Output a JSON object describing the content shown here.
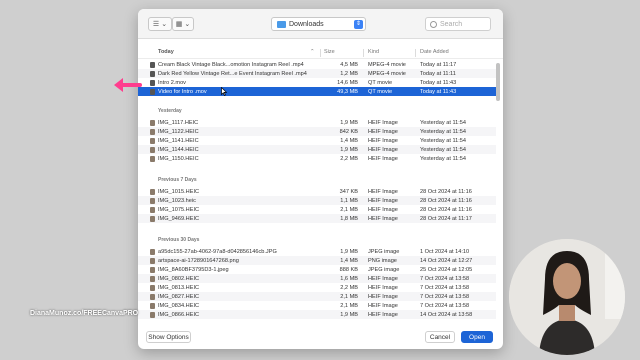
{
  "toolbar": {
    "location": "Downloads",
    "search_placeholder": "Search"
  },
  "columns": {
    "name": "Today",
    "size": "Size",
    "kind": "Kind",
    "date": "Date Added"
  },
  "sections": {
    "today": "Today",
    "yesterday": "Yesterday",
    "prev7": "Previous 7 Days",
    "prev30": "Previous 30 Days"
  },
  "files": {
    "today": [
      {
        "name": "Cream Black Vintage Black...omotion Instagram Reel .mp4",
        "size": "4,5 MB",
        "kind": "MPEG-4 movie",
        "date": "Today at 11:17"
      },
      {
        "name": "Dark Red Yellow Vintage Ret...e Event Instagram Reel .mp4",
        "size": "1,2 MB",
        "kind": "MPEG-4 movie",
        "date": "Today at 11:11"
      },
      {
        "name": "Intro 2.mov",
        "size": "14,6 MB",
        "kind": "QT movie",
        "date": "Today at 11:43"
      },
      {
        "name": "Video for Intro .mov",
        "size": "49,3 MB",
        "kind": "QT movie",
        "date": "Today at 11:43"
      }
    ],
    "yesterday": [
      {
        "name": "IMG_1117.HEIC",
        "size": "1,9 MB",
        "kind": "HEIF Image",
        "date": "Yesterday at 11:54"
      },
      {
        "name": "IMG_1122.HEIC",
        "size": "842 KB",
        "kind": "HEIF Image",
        "date": "Yesterday at 11:54"
      },
      {
        "name": "IMG_1141.HEIC",
        "size": "1,4 MB",
        "kind": "HEIF Image",
        "date": "Yesterday at 11:54"
      },
      {
        "name": "IMG_1144.HEIC",
        "size": "1,9 MB",
        "kind": "HEIF Image",
        "date": "Yesterday at 11:54"
      },
      {
        "name": "IMG_1150.HEIC",
        "size": "2,2 MB",
        "kind": "HEIF Image",
        "date": "Yesterday at 11:54"
      }
    ],
    "prev7": [
      {
        "name": "IMG_1015.HEIC",
        "size": "347 KB",
        "kind": "HEIF Image",
        "date": "28 Oct 2024 at 11:16"
      },
      {
        "name": "IMG_1023.heic",
        "size": "1,1 MB",
        "kind": "HEIF Image",
        "date": "28 Oct 2024 at 11:16"
      },
      {
        "name": "IMG_1075.HEIC",
        "size": "2,1 MB",
        "kind": "HEIF Image",
        "date": "28 Oct 2024 at 11:16"
      },
      {
        "name": "IMG_9469.HEIC",
        "size": "1,8 MB",
        "kind": "HEIF Image",
        "date": "28 Oct 2024 at 11:17"
      }
    ],
    "prev30": [
      {
        "name": "a95dc155-27ab-4062-97a8-d042856146cb.JPG",
        "size": "1,9 MB",
        "kind": "JPEG image",
        "date": "1 Oct 2024 at 14:10"
      },
      {
        "name": "artspace-ai-1728901647268.png",
        "size": "1,4 MB",
        "kind": "PNG image",
        "date": "14 Oct 2024 at 12:27"
      },
      {
        "name": "IMG_8A60BF3795D3-1.jpeg",
        "size": "888 KB",
        "kind": "JPEG image",
        "date": "25 Oct 2024 at 12:05"
      },
      {
        "name": "IMG_0802.HEIC",
        "size": "1,6 MB",
        "kind": "HEIF Image",
        "date": "7 Oct 2024 at 13:58"
      },
      {
        "name": "IMG_0813.HEIC",
        "size": "2,2 MB",
        "kind": "HEIF Image",
        "date": "7 Oct 2024 at 13:58"
      },
      {
        "name": "IMG_0827.HEIC",
        "size": "2,1 MB",
        "kind": "HEIF Image",
        "date": "7 Oct 2024 at 13:58"
      },
      {
        "name": "IMG_0834.HEIC",
        "size": "2,1 MB",
        "kind": "HEIF Image",
        "date": "7 Oct 2024 at 13:58"
      },
      {
        "name": "IMG_0866.HEIC",
        "size": "1,9 MB",
        "kind": "HEIF Image",
        "date": "14 Oct 2024 at 13:58"
      }
    ]
  },
  "footer": {
    "show_options": "Show Options",
    "cancel": "Cancel",
    "open": "Open"
  },
  "watermark": "DianaMunoz.co/FREECanvaPRO",
  "colors": {
    "selection": "#1d64d6",
    "annotation_arrow": "#ff3d8e",
    "folder": "#4a9ae8"
  }
}
